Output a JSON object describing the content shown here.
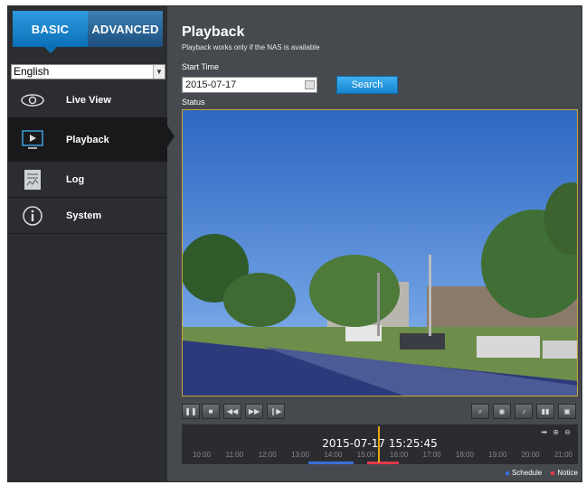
{
  "tabs": {
    "basic": "BASIC",
    "advanced": "ADVANCED"
  },
  "language": {
    "selected": "English"
  },
  "nav": [
    {
      "label": "Live View",
      "icon": "eye-icon"
    },
    {
      "label": "Playback",
      "icon": "monitor-icon"
    },
    {
      "label": "Log",
      "icon": "document-icon"
    },
    {
      "label": "System",
      "icon": "info-icon"
    }
  ],
  "main": {
    "title": "Playback",
    "subtitle": "Playback works only if the NAS is available",
    "start_time_label": "Start Time",
    "start_date_value": "2015-07-17",
    "search_label": "Search",
    "status_label": "Status"
  },
  "controls": {
    "left_icons": [
      "pause-icon",
      "stop-icon",
      "rewind-icon",
      "fast-forward-icon",
      "step-forward-icon"
    ],
    "right_icons": [
      "zoom-icon",
      "snapshot-icon",
      "audio-icon",
      "signal-icon",
      "fullscreen-icon"
    ]
  },
  "timeline": {
    "current_time": "2015-07-17 15:25:45",
    "hours": [
      "10:00",
      "11:00",
      "12:00",
      "13:00",
      "14:00",
      "15:00",
      "16:00",
      "17:00",
      "18:00",
      "19:00",
      "20:00",
      "21:00"
    ]
  },
  "legend": {
    "schedule": "Schedule",
    "notice": "Notice"
  },
  "colors": {
    "accent": "#1784d0",
    "schedule": "#3a6fd8",
    "notice": "#e23a4a",
    "marker": "#e8a515"
  }
}
